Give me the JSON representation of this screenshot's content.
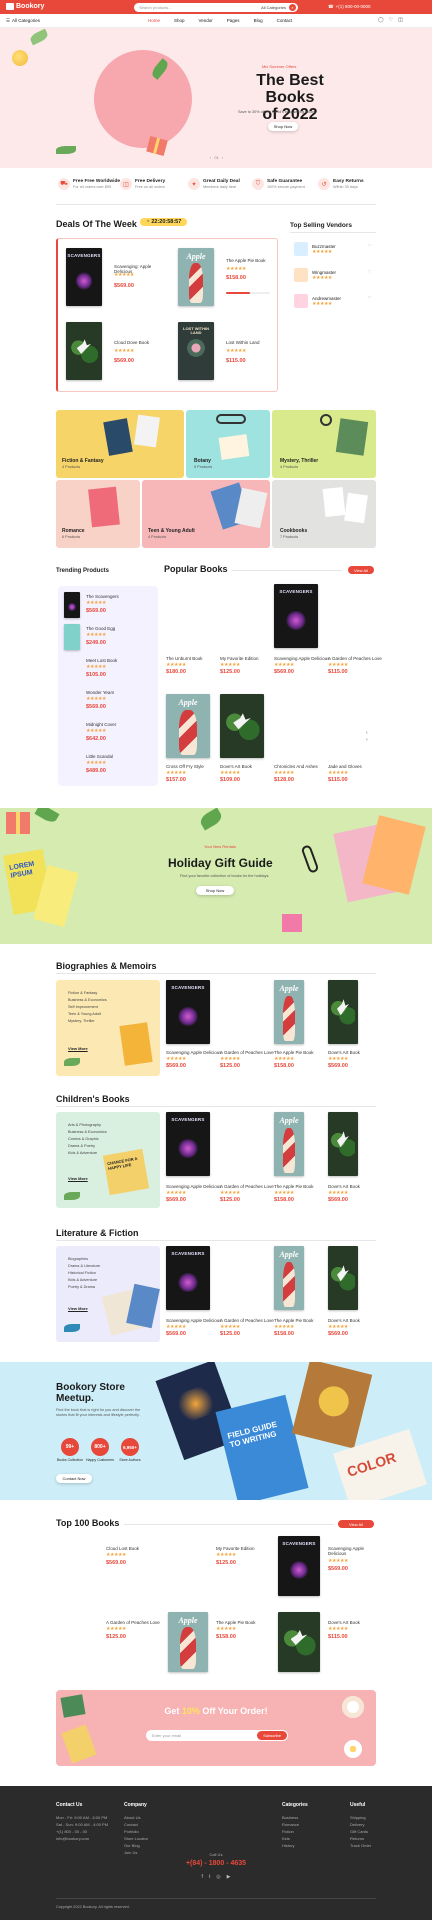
{
  "header": {
    "logo": "Bookory",
    "search_placeholder": "Search products...",
    "category": "All Categories",
    "phone": "+(1) 800-00-0000",
    "nav": [
      "Home",
      "Shop",
      "Vendor",
      "Pages",
      "Blog",
      "Contact"
    ]
  },
  "hero": {
    "line": "Mix Summer Offers",
    "title_1": "The Best Books",
    "title_2": "of 2022",
    "sub": "Save to 30% off the world's best-selling books.",
    "cta": "Shop Now",
    "pager": "01"
  },
  "features": [
    {
      "title": "Free Free Worldwide",
      "sub": "For all orders over $99"
    },
    {
      "title": "Free Delivery",
      "sub": "Free on all orders"
    },
    {
      "title": "Great Daily Deal",
      "sub": "Members daily deal"
    },
    {
      "title": "Safe Guarantee",
      "sub": "100% secure payment"
    },
    {
      "title": "Easy Returns",
      "sub": "Within 30 days"
    }
  ],
  "deals": {
    "title": "Deals Of The Week",
    "timer": "22:20:58:57",
    "items": [
      {
        "title": "Scavenging: Apple Delicious",
        "price": "$569.00"
      },
      {
        "title": "The Apple Pie Book",
        "price": "$158.00"
      },
      {
        "title": "Cloud Dove Book",
        "price": "$569.00"
      },
      {
        "title": "Lost Within Land",
        "price": "$115.00"
      }
    ]
  },
  "vendors": {
    "title": "Top Selling Vendors",
    "items": [
      {
        "name": "Buzzmaster"
      },
      {
        "name": "Wingmaster"
      },
      {
        "name": "Andrewmaster"
      }
    ]
  },
  "categories": [
    {
      "name": "Fiction & Fantasy",
      "count": "4 Products"
    },
    {
      "name": "Botany",
      "count": "5 Products"
    },
    {
      "name": "Mystery, Thriller",
      "count": "4 Products"
    },
    {
      "name": "Romance",
      "count": "6 Products"
    },
    {
      "name": "Teen & Young Adult",
      "count": "4 Products"
    },
    {
      "name": "Cookbooks",
      "count": "7 Products"
    }
  ],
  "trending": {
    "title": "Trending Products",
    "items": [
      {
        "title": "The Scavengers",
        "price": "$569.00"
      },
      {
        "title": "The Good Egg",
        "price": "$249.00"
      },
      {
        "title": "Meet Lost Book",
        "price": "$105.00"
      },
      {
        "title": "Wonder Years",
        "price": "$569.00"
      },
      {
        "title": "Midnight Cover",
        "price": "$642.00"
      },
      {
        "title": "Little Scandal",
        "price": "$489.00"
      }
    ]
  },
  "popular": {
    "title": "Popular Books",
    "cta": "View All",
    "items": [
      {
        "title": "The Unburnt Book",
        "price": "$180.00"
      },
      {
        "title": "My Favorite Edition",
        "price": "$125.00"
      },
      {
        "title": "Scavenging Apple Delicious",
        "price": "$569.00"
      },
      {
        "title": "A Garden of Peaches Love",
        "price": "$115.00"
      },
      {
        "title": "Cross Off Fry Style",
        "price": "$157.00"
      },
      {
        "title": "Dove's Art Book",
        "price": "$109.00"
      },
      {
        "title": "Chronicles And Ashes",
        "price": "$128.00"
      },
      {
        "title": "Jade and Gloves",
        "price": "$115.00"
      }
    ]
  },
  "holiday": {
    "sub": "Your New Rentals",
    "title": "Holiday Gift Guide",
    "text": "Find your favorite collection of books for the holidays.",
    "cta": "Shop Now",
    "book_word": "LOREM IPSUM"
  },
  "bio": {
    "title": "Biographies & Memoirs",
    "links": [
      "Fiction & Fantasy",
      "Business & Economics",
      "Self Improvement",
      "Teen & Young Adult",
      "Mystery, Thriller"
    ],
    "cta": "View More",
    "items": [
      {
        "title": "Scavenging Apple Delicious",
        "price": "$569.00"
      },
      {
        "title": "A Garden of Peaches Love",
        "price": "$125.00"
      },
      {
        "title": "The Apple Pie Book",
        "price": "$158.00"
      },
      {
        "title": "Dove's Art Book",
        "price": "$569.00"
      }
    ]
  },
  "children": {
    "title": "Children's Books",
    "links": [
      "Arts & Photography",
      "Business & Economics",
      "Comics & Graphic",
      "Drama & Poetry",
      "Kids & Adventure"
    ],
    "cta": "View More",
    "items": [
      {
        "title": "Scavenging Apple Delicious",
        "price": "$569.00"
      },
      {
        "title": "A Garden of Peaches Love",
        "price": "$125.00"
      },
      {
        "title": "The Apple Pie Book",
        "price": "$158.00"
      },
      {
        "title": "Dove's Art Book",
        "price": "$569.00"
      }
    ],
    "book_word": "CHANCE FOR A HAPPY LIFE"
  },
  "literature": {
    "title": "Literature & Fiction",
    "links": [
      "Biographies",
      "Drama & Literature",
      "Historical Fiction",
      "Kids & Adventure",
      "Poetry & Drama"
    ],
    "cta": "View More",
    "items": [
      {
        "title": "Scavenging Apple Delicious",
        "price": "$569.00"
      },
      {
        "title": "A Garden of Peaches Love",
        "price": "$125.00"
      },
      {
        "title": "The Apple Pie Book",
        "price": "$158.00"
      },
      {
        "title": "Dove's Art Book",
        "price": "$569.00"
      }
    ]
  },
  "meetup": {
    "title_1": "Bookory Store",
    "title_2": "Meetup.",
    "text": "Find the book that is right for you and discover the stories that fit your interests and lifestyle perfectly.",
    "stats": [
      {
        "value": "99+",
        "label": "Books Collection"
      },
      {
        "value": "800+",
        "label": "Happy Customers"
      },
      {
        "value": "6,950+",
        "label": "Store Authors"
      }
    ],
    "cta": "Contact Now",
    "book1": "FIELD GUIDE TO WRITING",
    "book2": "COLOR"
  },
  "top100": {
    "title": "Top 100 Books",
    "cta": "View All",
    "items": [
      {
        "title": "Cloud Lost Book",
        "price": "$569.00"
      },
      {
        "title": "My Favorite Edition",
        "price": "$125.00"
      },
      {
        "title": "Scavenging Apple Delicious",
        "price": "$569.00"
      },
      {
        "title": "A Garden of Peaches Love",
        "price": "$125.00"
      },
      {
        "title": "The Apple Pie Book",
        "price": "$158.00"
      },
      {
        "title": "Dove's Art Book",
        "price": "$115.00"
      }
    ]
  },
  "newsletter": {
    "title_pre": "Get ",
    "title_pct": "10%",
    "title_post": " Off Your Order!",
    "placeholder": "Enter your email",
    "cta": "Subscribe"
  },
  "footer": {
    "col1_title": "Contact Us",
    "col1_lines": [
      "Mon - Fri: 9:00 AM - 6:00 PM",
      "Sat - Sun: 9:00 AM - 4:00 PM",
      "+(1) 800 - 00 - 00",
      "info@bookory.com"
    ],
    "col2_title": "Company",
    "col2_lines": [
      "About Us",
      "Contact",
      "Portfolio",
      "Store Locator",
      "Our Blog",
      "Join Us"
    ],
    "col3_title": "Categories",
    "col3_lines": [
      "Business",
      "Romance",
      "Fiction",
      "Kids",
      "History"
    ],
    "col4_title": "Useful",
    "col4_lines": [
      "Shipping",
      "Delivery",
      "Gift Cards",
      "Returns",
      "Track Order"
    ],
    "phone_label": "Call Us",
    "phone": "+(84) - 1800 - 4635",
    "copyright": "Copyright 2022 Bookory. All rights reserved."
  },
  "colors": {
    "accent": "#e8483a",
    "hero_bg": "#fde9ea",
    "dark": "#222222"
  }
}
